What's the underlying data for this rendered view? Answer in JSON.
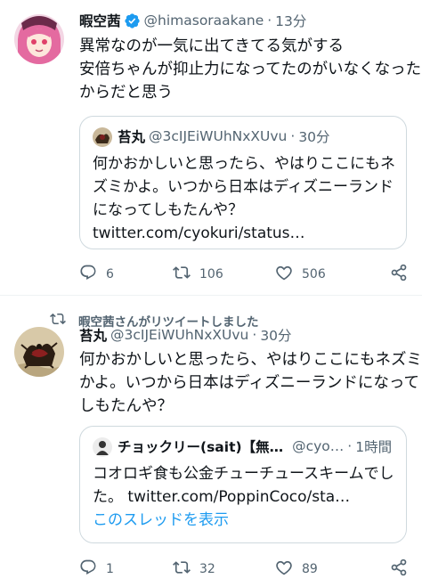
{
  "tweet1": {
    "name": "暇空茜",
    "handle": "@himasoraakane",
    "separator": "·",
    "time": "13分",
    "text_lines": [
      "異常なのが一気に出てきてる気がする",
      "安倍ちゃんが抑止力になってたのがいなくなった",
      "からだと思う"
    ],
    "quote": {
      "name": "苔丸",
      "handle": "@3cIJEiWUhNxXUvu",
      "separator": "·",
      "time": "30分",
      "text_lines": [
        "何かおかしいと思ったら、やはりここにもネ",
        "ズミかよ。いつから日本はディズニーランド",
        "になってしもたんや？",
        "twitter.com/cyokuri/status…"
      ]
    },
    "actions": {
      "replies": "6",
      "retweets": "106",
      "likes": "506"
    }
  },
  "tweet2": {
    "retweet_label": "暇空茜さんがリツイートしました",
    "name": "苔丸",
    "handle": "@3cIJEiWUhNxXUvu",
    "separator": "·",
    "time": "30分",
    "text_lines": [
      "何かおかしいと思ったら、やはりここにもネズミ",
      "かよ。いつから日本はディズニーランドになって",
      "しもたんや？"
    ],
    "quote": {
      "name": "チョックリー(sait)【無…",
      "handle": "@cyo…",
      "separator": "·",
      "time": "1時間",
      "text_lines": [
        "コオロギ食も公金チューチュースキームでし",
        "た。 twitter.com/PoppinCoco/sta…"
      ],
      "thread_link": "このスレッドを表示"
    },
    "actions": {
      "replies": "1",
      "retweets": "32",
      "likes": "89"
    }
  },
  "colors": {
    "accent": "#1d9bf0",
    "secondary_text": "#536471",
    "border": "#cfd9de"
  },
  "icons": [
    "verified-badge-icon",
    "reply-icon",
    "retweet-icon",
    "like-icon",
    "share-icon"
  ]
}
